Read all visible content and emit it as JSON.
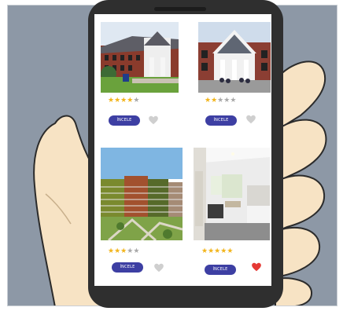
{
  "colors": {
    "background": "#8d98a6",
    "phone_body": "#2f2f2f",
    "button": "#3d3fa3",
    "star_filled": "#f2b51c",
    "star_empty": "#a9a9a9",
    "heart_liked": "#e53935",
    "heart_unliked": "#cfcfcf"
  },
  "listings": [
    {
      "image": "brick-campus-building-photo",
      "rating": 4,
      "max_rating": 5,
      "button_label": "İNCELE",
      "favorite": false
    },
    {
      "image": "white-gabled-hall-photo",
      "rating": 2,
      "max_rating": 5,
      "button_label": "İNCELE",
      "favorite": false
    },
    {
      "image": "apartment-blocks-courtyard-photo",
      "rating": 3,
      "max_rating": 5,
      "button_label": "İNCELE",
      "favorite": false
    },
    {
      "image": "dorm-room-interior-photo",
      "rating": 5,
      "max_rating": 5,
      "button_label": "İNCELE",
      "favorite": true
    }
  ]
}
